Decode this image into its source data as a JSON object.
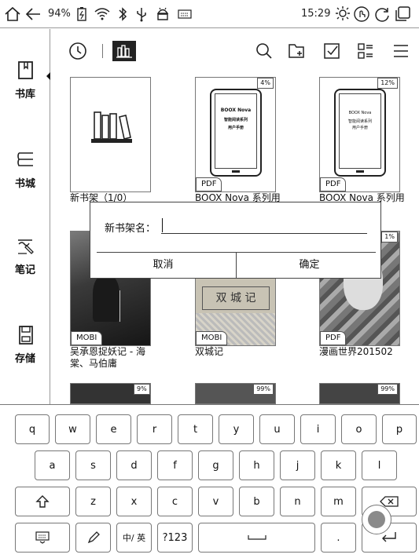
{
  "status": {
    "battery": "94%",
    "time": "15:29"
  },
  "sidebar": {
    "items": [
      {
        "label": "书库"
      },
      {
        "label": "书城"
      },
      {
        "label": "笔记"
      },
      {
        "label": "存储"
      }
    ]
  },
  "books": [
    {
      "title": "新书架（1/0）",
      "format": "",
      "progress": "",
      "cover_icon": "bookshelf-icon"
    },
    {
      "title": "BOOX Nova 系列用",
      "format": "PDF",
      "progress": "4%",
      "cover_lines": [
        "BOOX Nova",
        "智能阅读系列",
        "用户手册"
      ]
    },
    {
      "title": "BOOX Nova 系列用",
      "format": "PDF",
      "progress": "12%",
      "cover_lines": [
        "BOOX Nova",
        "智能阅读系列",
        "用户手册"
      ]
    },
    {
      "title": "吴承恩捉妖记 - 海棠、马伯庸",
      "format": "MOBI",
      "progress": ""
    },
    {
      "title": "双城记",
      "format": "MOBI",
      "progress": "",
      "cover_lines": [
        "双 城 记"
      ]
    },
    {
      "title": "漫画世界201502",
      "format": "PDF",
      "progress": "1%"
    },
    {
      "title": "",
      "format": "",
      "progress": "9%"
    },
    {
      "title": "",
      "format": "",
      "progress": "99%"
    },
    {
      "title": "",
      "format": "",
      "progress": "99%"
    }
  ],
  "dialog": {
    "label": "新书架名：",
    "input_value": "",
    "cancel": "取消",
    "confirm": "确定"
  },
  "keyboard": {
    "row1": [
      "q",
      "w",
      "e",
      "r",
      "t",
      "y",
      "u",
      "i",
      "o",
      "p"
    ],
    "row2": [
      "a",
      "s",
      "d",
      "f",
      "g",
      "h",
      "j",
      "k",
      "l"
    ],
    "row3": [
      "z",
      "x",
      "c",
      "v",
      "b",
      "n",
      "m"
    ],
    "lang_label": "中/ 英",
    "num_label": "?123",
    "period": "."
  },
  "colors": {
    "accent": "#222222",
    "border": "#777777"
  }
}
